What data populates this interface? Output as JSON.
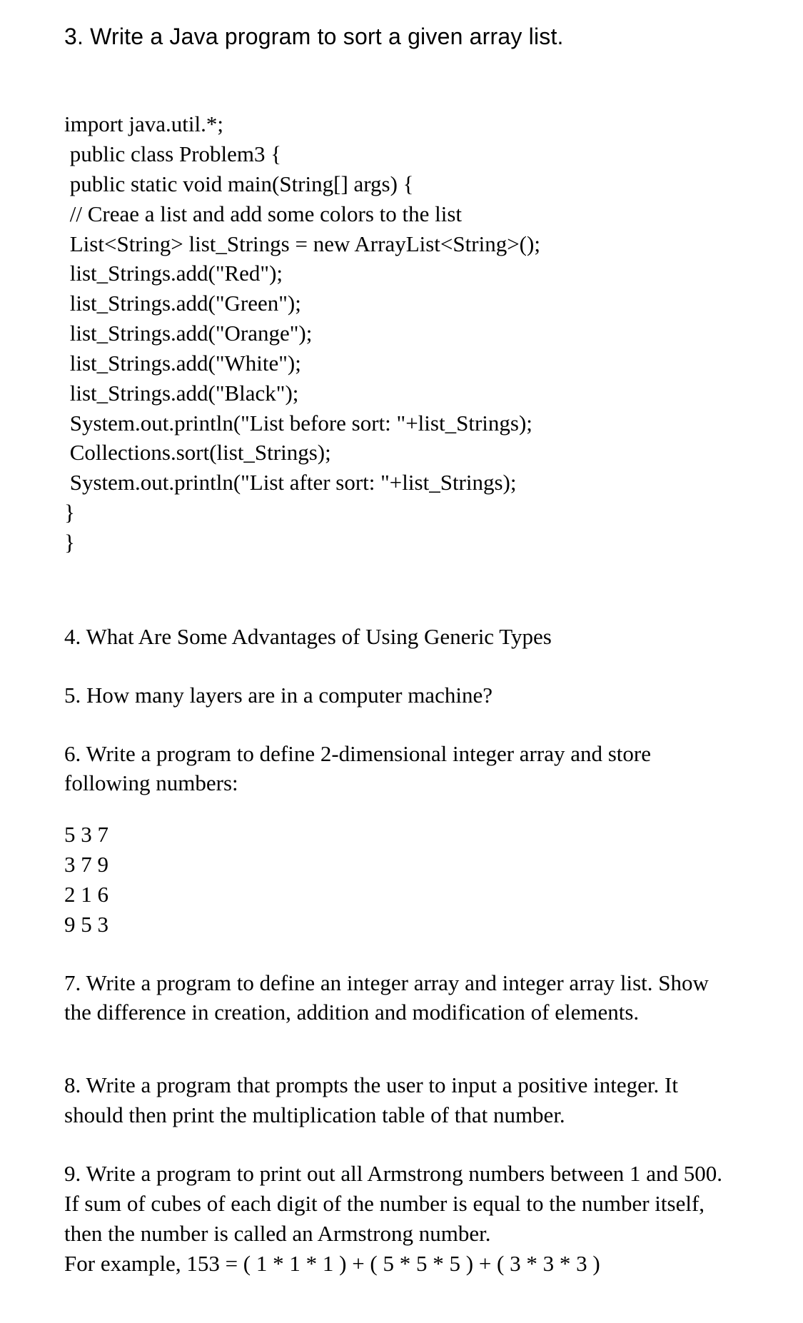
{
  "heading": "3. Write a Java program to sort a given array list.",
  "code": "import java.util.*;\n public class Problem3 {\n public static void main(String[] args) {\n // Creae a list and add some colors to the list\n List<String> list_Strings = new ArrayList<String>();\n list_Strings.add(\"Red\");\n list_Strings.add(\"Green\");\n list_Strings.add(\"Orange\");\n list_Strings.add(\"White\");\n list_Strings.add(\"Black\");\n System.out.println(\"List before sort: \"+list_Strings);\n Collections.sort(list_Strings);\n System.out.println(\"List after sort: \"+list_Strings);\n}\n}",
  "q4": "4. What Are Some Advantages of Using Generic Types",
  "q5": "5. How many layers are in a computer machine?",
  "q6": "6. Write a program to define 2-dimensional integer array and store following numbers:",
  "matrix": "5 3 7\n3 7 9\n2 1 6\n9 5 3",
  "q7": "7. Write a program to define an integer array and integer array list. Show the difference in creation, addition and modification of elements.",
  "q8": "8. Write a program that prompts the user to input a positive integer. It should then print the multiplication table of that number.",
  "q9": "9. Write a program to print out all Armstrong numbers between 1 and 500. If sum of cubes of each digit of the number is equal to the number itself, then the number is called an Armstrong number.",
  "q9_example": "For example, 153 = ( 1 * 1 * 1 ) + ( 5 * 5 * 5 ) + ( 3 * 3 * 3 )"
}
